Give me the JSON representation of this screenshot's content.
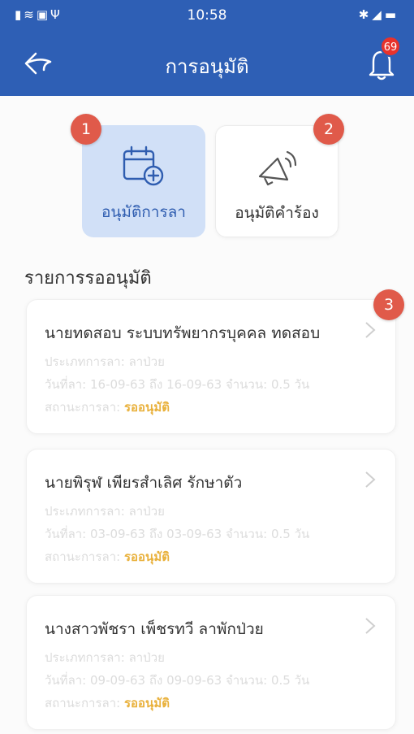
{
  "status_bar": {
    "time": "10:58",
    "left_icons": "signal wifi image usb",
    "right_icons": "bluetooth mute battery"
  },
  "header": {
    "title": "การอนุมัติ",
    "notification_count": "69"
  },
  "tiles": [
    {
      "label": "อนุมัติการลา",
      "badge": "1",
      "icon": "calendar-plus-icon"
    },
    {
      "label": "อนุมัติคำร้อง",
      "badge": "2",
      "icon": "megaphone-icon"
    }
  ],
  "section_title": "รายการรออนุมัติ",
  "list_badge": "3",
  "requests": [
    {
      "name": "นายทดสอบ ระบบทรัพยากรบุคคล ทดสอบ",
      "type_label": "ประเภทการลา:",
      "type_value": "ลาป่วย",
      "date_label": "วันที่ลา:",
      "date_from": "16-09-63",
      "to_label": "ถึง",
      "date_to": "16-09-63",
      "amount_label": "จำนวน:",
      "amount": "0.5",
      "unit": "วัน",
      "status_label": "สถานะการลา:",
      "status_value": "รออนุมัติ"
    },
    {
      "name": "นายพิรุฬ เพียรสำเลิศ รักษาตัว",
      "type_label": "ประเภทการลา:",
      "type_value": "ลาป่วย",
      "date_label": "วันที่ลา:",
      "date_from": "03-09-63",
      "to_label": "ถึง",
      "date_to": "03-09-63",
      "amount_label": "จำนวน:",
      "amount": "0.5",
      "unit": "วัน",
      "status_label": "สถานะการลา:",
      "status_value": "รออนุมัติ"
    },
    {
      "name": "นางสาวพัชรา เพ็ชรทวี ลาพักป่วย",
      "type_label": "ประเภทการลา:",
      "type_value": "ลาป่วย",
      "date_label": "วันที่ลา:",
      "date_from": "09-09-63",
      "to_label": "ถึง",
      "date_to": "09-09-63",
      "amount_label": "จำนวน:",
      "amount": "0.5",
      "unit": "วัน",
      "status_label": "สถานะการลา:",
      "status_value": "รออนุมัติ"
    }
  ],
  "colors": {
    "primary": "#2e5fb5",
    "tile_active": "#d1e0f7",
    "badge": "#e05a4a",
    "status": "#e9b13c"
  }
}
